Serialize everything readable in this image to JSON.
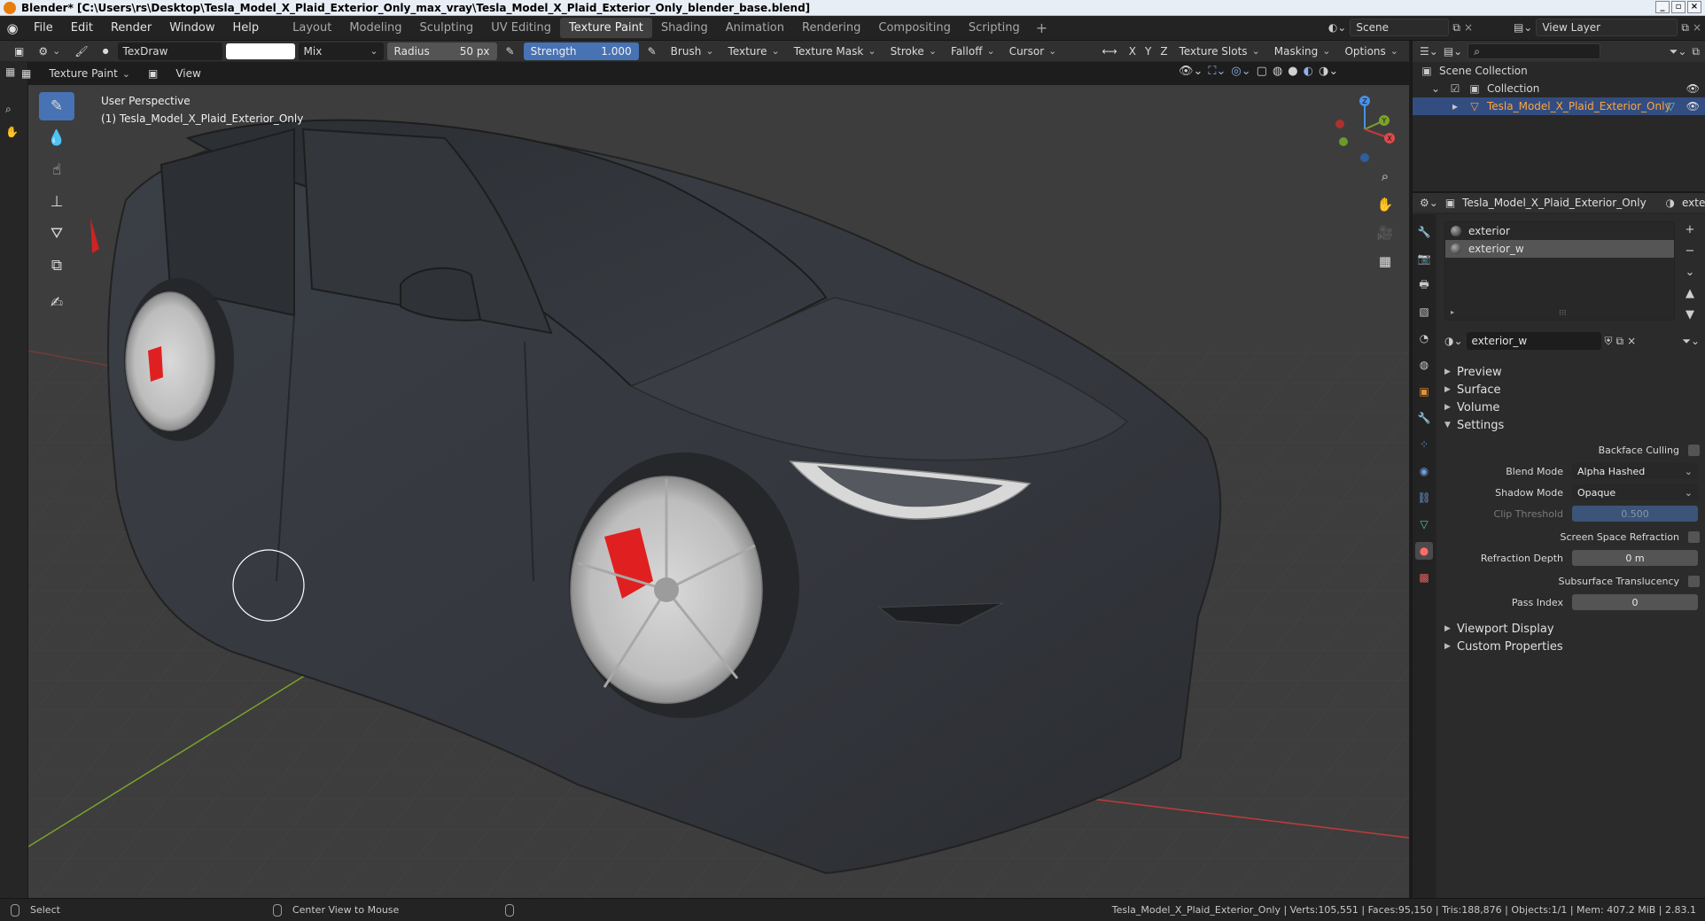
{
  "window": {
    "title": "Blender* [C:\\Users\\rs\\Desktop\\Tesla_Model_X_Plaid_Exterior_Only_max_vray\\Tesla_Model_X_Plaid_Exterior_Only_blender_base.blend]"
  },
  "menu": [
    "File",
    "Edit",
    "Render",
    "Window",
    "Help"
  ],
  "workspaces": [
    "Layout",
    "Modeling",
    "Sculpting",
    "UV Editing",
    "Texture Paint",
    "Shading",
    "Animation",
    "Rendering",
    "Compositing",
    "Scripting"
  ],
  "active_workspace": "Texture Paint",
  "scene": {
    "name": "Scene",
    "view_layer": "View Layer"
  },
  "tool_header": {
    "brush_name": "TexDraw",
    "color_swatch": "#ffffff",
    "blend": "Mix",
    "radius_label": "Radius",
    "radius_value": "50 px",
    "strength_label": "Strength",
    "strength_value": "1.000",
    "brush": "Brush",
    "texture": "Texture",
    "texture_mask": "Texture Mask",
    "stroke": "Stroke",
    "falloff": "Falloff",
    "cursor": "Cursor",
    "x": "X",
    "y": "Y",
    "z": "Z",
    "texture_slots": "Texture Slots",
    "masking": "Masking",
    "options": "Options"
  },
  "viewport_header": {
    "mode": "Texture Paint",
    "view": "View"
  },
  "viewport": {
    "perspective": "User Perspective",
    "object_label": "(1) Tesla_Model_X_Plaid_Exterior_Only",
    "gizmo_axes": [
      "X",
      "Y",
      "Z"
    ],
    "brush_cursor_color": "#ffffff"
  },
  "toolbar_icons": [
    "draw-brush-icon",
    "soften-icon",
    "smear-icon",
    "clone-icon",
    "fill-icon",
    "mask-icon",
    "annotate-icon"
  ],
  "outliner": {
    "root": "Scene Collection",
    "collection": "Collection",
    "object": "Tesla_Model_X_Plaid_Exterior_Only"
  },
  "properties": {
    "object_name": "Tesla_Model_X_Plaid_Exterior_Only",
    "material_tab_text": "exter",
    "material_slots": [
      "exterior",
      "exterior_w"
    ],
    "active_material": "exterior_w",
    "sections": {
      "preview": "Preview",
      "surface": "Surface",
      "volume": "Volume",
      "settings": "Settings",
      "viewport_display": "Viewport Display",
      "custom_properties": "Custom Properties"
    },
    "settings": {
      "backface_culling": "Backface Culling",
      "blend_mode_label": "Blend Mode",
      "blend_mode": "Alpha Hashed",
      "shadow_mode_label": "Shadow Mode",
      "shadow_mode": "Opaque",
      "clip_threshold_label": "Clip Threshold",
      "clip_threshold": "0.500",
      "screen_space_refraction": "Screen Space Refraction",
      "refraction_depth_label": "Refraction Depth",
      "refraction_depth": "0 m",
      "subsurface_translucency": "Subsurface Translucency",
      "pass_index_label": "Pass Index",
      "pass_index": "0"
    }
  },
  "statusbar": {
    "select": "Select",
    "center_view": "Center View to Mouse",
    "stats": "Tesla_Model_X_Plaid_Exterior_Only | Verts:105,551 | Faces:95,150 | Tris:188,876 | Objects:1/1 | Mem: 407.2 MiB | 2.83.1"
  },
  "colors": {
    "accent": "#4772b3",
    "selected_object": "#ffa43c",
    "car_body": "#3a3d42",
    "brake_caliper": "#e02020",
    "x_axis": "#c23a3a",
    "y_axis": "#7aa32a"
  }
}
